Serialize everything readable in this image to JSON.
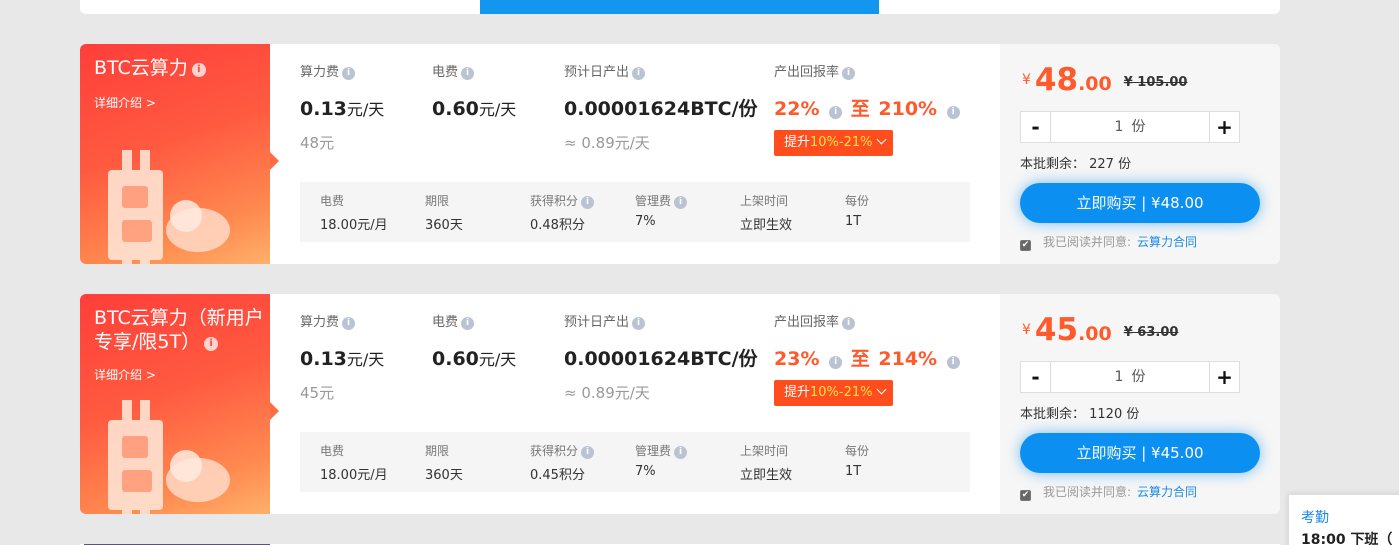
{
  "currency_symbol": "¥",
  "info_glyph": "i",
  "products": [
    {
      "title": "BTC云算力",
      "detail_link": "详细介绍 >",
      "hash_fee": {
        "label": "算力费",
        "value": "0.13",
        "unit": "元/天",
        "sub": "48元"
      },
      "elec_fee": {
        "label": "电费",
        "value": "0.60",
        "unit": "元/天"
      },
      "daily_output": {
        "label": "预计日产出",
        "value": "0.00001624BTC/份",
        "sub": "≈ 0.89元/天"
      },
      "return_rate": {
        "label": "产出回报率",
        "low": "22%",
        "sep": "至",
        "high": "210%",
        "boost_prefix": "提升",
        "boost_range": "10%-21%"
      },
      "specs": [
        {
          "key": "电费",
          "value": "18.00元/月",
          "info": false
        },
        {
          "key": "期限",
          "value": "360天",
          "info": false
        },
        {
          "key": "获得积分",
          "value": "0.48积分",
          "info": true
        },
        {
          "key": "管理费",
          "value": "7%",
          "info": true
        },
        {
          "key": "上架时间",
          "value": "立即生效",
          "info": false
        },
        {
          "key": "每份",
          "value": "1T",
          "info": false
        }
      ],
      "price_int": "48",
      "price_dec": ".00",
      "price_orig": "¥ 105.00",
      "qty": "1",
      "qty_unit": "份",
      "minus": "-",
      "plus": "+",
      "remain": "本批剩余： 227 份",
      "buy_label": "立即购买 | ¥48.00",
      "agree_text": "我已阅读并同意:",
      "agree_link": "云算力合同",
      "agree_checked": "✔"
    },
    {
      "title": "BTC云算力（新用户专享/限5T）",
      "detail_link": "详细介绍 >",
      "hash_fee": {
        "label": "算力费",
        "value": "0.13",
        "unit": "元/天",
        "sub": "45元"
      },
      "elec_fee": {
        "label": "电费",
        "value": "0.60",
        "unit": "元/天"
      },
      "daily_output": {
        "label": "预计日产出",
        "value": "0.00001624BTC/份",
        "sub": "≈ 0.89元/天"
      },
      "return_rate": {
        "label": "产出回报率",
        "low": "23%",
        "sep": "至",
        "high": "214%",
        "boost_prefix": "提升",
        "boost_range": "10%-21%"
      },
      "specs": [
        {
          "key": "电费",
          "value": "18.00元/月",
          "info": false
        },
        {
          "key": "期限",
          "value": "360天",
          "info": false
        },
        {
          "key": "获得积分",
          "value": "0.45积分",
          "info": true
        },
        {
          "key": "管理费",
          "value": "7%",
          "info": true
        },
        {
          "key": "上架时间",
          "value": "立即生效",
          "info": false
        },
        {
          "key": "每份",
          "value": "1T",
          "info": false
        }
      ],
      "price_int": "45",
      "price_dec": ".00",
      "price_orig": "¥ 63.00",
      "qty": "1",
      "qty_unit": "份",
      "minus": "-",
      "plus": "+",
      "remain": "本批剩余： 1120 份",
      "buy_label": "立即购买 | ¥45.00",
      "agree_text": "我已阅读并同意:",
      "agree_link": "云算力合同",
      "agree_checked": "✔"
    }
  ],
  "popup": {
    "title": "考勤",
    "value": "18:00 下班（"
  },
  "colors": {
    "accent_blue": "#0b8ff0",
    "price_red": "#ff5a2b",
    "card_red": "#ff3e3a"
  }
}
